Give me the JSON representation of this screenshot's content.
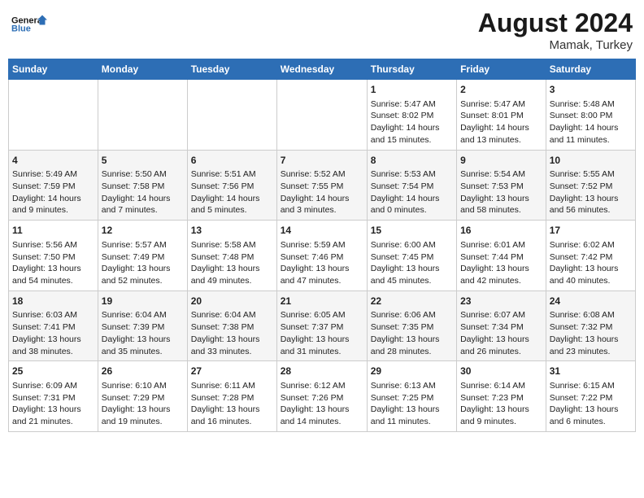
{
  "logo": {
    "line1": "General",
    "line2": "Blue"
  },
  "title": "August 2024",
  "location": "Mamak, Turkey",
  "days_of_week": [
    "Sunday",
    "Monday",
    "Tuesday",
    "Wednesday",
    "Thursday",
    "Friday",
    "Saturday"
  ],
  "weeks": [
    [
      {
        "day": "",
        "info": ""
      },
      {
        "day": "",
        "info": ""
      },
      {
        "day": "",
        "info": ""
      },
      {
        "day": "",
        "info": ""
      },
      {
        "day": "1",
        "info": "Sunrise: 5:47 AM\nSunset: 8:02 PM\nDaylight: 14 hours\nand 15 minutes."
      },
      {
        "day": "2",
        "info": "Sunrise: 5:47 AM\nSunset: 8:01 PM\nDaylight: 14 hours\nand 13 minutes."
      },
      {
        "day": "3",
        "info": "Sunrise: 5:48 AM\nSunset: 8:00 PM\nDaylight: 14 hours\nand 11 minutes."
      }
    ],
    [
      {
        "day": "4",
        "info": "Sunrise: 5:49 AM\nSunset: 7:59 PM\nDaylight: 14 hours\nand 9 minutes."
      },
      {
        "day": "5",
        "info": "Sunrise: 5:50 AM\nSunset: 7:58 PM\nDaylight: 14 hours\nand 7 minutes."
      },
      {
        "day": "6",
        "info": "Sunrise: 5:51 AM\nSunset: 7:56 PM\nDaylight: 14 hours\nand 5 minutes."
      },
      {
        "day": "7",
        "info": "Sunrise: 5:52 AM\nSunset: 7:55 PM\nDaylight: 14 hours\nand 3 minutes."
      },
      {
        "day": "8",
        "info": "Sunrise: 5:53 AM\nSunset: 7:54 PM\nDaylight: 14 hours\nand 0 minutes."
      },
      {
        "day": "9",
        "info": "Sunrise: 5:54 AM\nSunset: 7:53 PM\nDaylight: 13 hours\nand 58 minutes."
      },
      {
        "day": "10",
        "info": "Sunrise: 5:55 AM\nSunset: 7:52 PM\nDaylight: 13 hours\nand 56 minutes."
      }
    ],
    [
      {
        "day": "11",
        "info": "Sunrise: 5:56 AM\nSunset: 7:50 PM\nDaylight: 13 hours\nand 54 minutes."
      },
      {
        "day": "12",
        "info": "Sunrise: 5:57 AM\nSunset: 7:49 PM\nDaylight: 13 hours\nand 52 minutes."
      },
      {
        "day": "13",
        "info": "Sunrise: 5:58 AM\nSunset: 7:48 PM\nDaylight: 13 hours\nand 49 minutes."
      },
      {
        "day": "14",
        "info": "Sunrise: 5:59 AM\nSunset: 7:46 PM\nDaylight: 13 hours\nand 47 minutes."
      },
      {
        "day": "15",
        "info": "Sunrise: 6:00 AM\nSunset: 7:45 PM\nDaylight: 13 hours\nand 45 minutes."
      },
      {
        "day": "16",
        "info": "Sunrise: 6:01 AM\nSunset: 7:44 PM\nDaylight: 13 hours\nand 42 minutes."
      },
      {
        "day": "17",
        "info": "Sunrise: 6:02 AM\nSunset: 7:42 PM\nDaylight: 13 hours\nand 40 minutes."
      }
    ],
    [
      {
        "day": "18",
        "info": "Sunrise: 6:03 AM\nSunset: 7:41 PM\nDaylight: 13 hours\nand 38 minutes."
      },
      {
        "day": "19",
        "info": "Sunrise: 6:04 AM\nSunset: 7:39 PM\nDaylight: 13 hours\nand 35 minutes."
      },
      {
        "day": "20",
        "info": "Sunrise: 6:04 AM\nSunset: 7:38 PM\nDaylight: 13 hours\nand 33 minutes."
      },
      {
        "day": "21",
        "info": "Sunrise: 6:05 AM\nSunset: 7:37 PM\nDaylight: 13 hours\nand 31 minutes."
      },
      {
        "day": "22",
        "info": "Sunrise: 6:06 AM\nSunset: 7:35 PM\nDaylight: 13 hours\nand 28 minutes."
      },
      {
        "day": "23",
        "info": "Sunrise: 6:07 AM\nSunset: 7:34 PM\nDaylight: 13 hours\nand 26 minutes."
      },
      {
        "day": "24",
        "info": "Sunrise: 6:08 AM\nSunset: 7:32 PM\nDaylight: 13 hours\nand 23 minutes."
      }
    ],
    [
      {
        "day": "25",
        "info": "Sunrise: 6:09 AM\nSunset: 7:31 PM\nDaylight: 13 hours\nand 21 minutes."
      },
      {
        "day": "26",
        "info": "Sunrise: 6:10 AM\nSunset: 7:29 PM\nDaylight: 13 hours\nand 19 minutes."
      },
      {
        "day": "27",
        "info": "Sunrise: 6:11 AM\nSunset: 7:28 PM\nDaylight: 13 hours\nand 16 minutes."
      },
      {
        "day": "28",
        "info": "Sunrise: 6:12 AM\nSunset: 7:26 PM\nDaylight: 13 hours\nand 14 minutes."
      },
      {
        "day": "29",
        "info": "Sunrise: 6:13 AM\nSunset: 7:25 PM\nDaylight: 13 hours\nand 11 minutes."
      },
      {
        "day": "30",
        "info": "Sunrise: 6:14 AM\nSunset: 7:23 PM\nDaylight: 13 hours\nand 9 minutes."
      },
      {
        "day": "31",
        "info": "Sunrise: 6:15 AM\nSunset: 7:22 PM\nDaylight: 13 hours\nand 6 minutes."
      }
    ]
  ]
}
